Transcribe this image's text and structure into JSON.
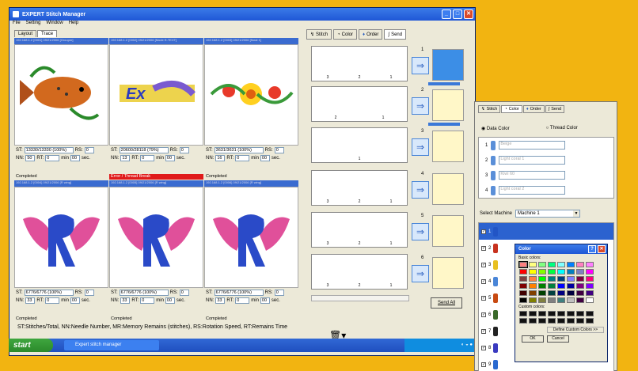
{
  "app": {
    "title": "EXPERT Stitch Manager",
    "menu": [
      "File",
      "Setting",
      "Window",
      "Help"
    ],
    "tabs": [
      "Layout",
      "Trace"
    ]
  },
  "grid": {
    "cells": [
      {
        "title": "192.168.1.2 [0001] 09/21/2006 [Grouper]",
        "st": "13330/13330 (100%)",
        "rs": "0",
        "nn": "50",
        "rt": "0",
        "min": "00",
        "status": "Completed",
        "status_kind": "ok",
        "design": "fish"
      },
      {
        "title": "192.168.1.2 [0002] 09/21/2006 [Mode E-TEXT]",
        "st": "20600/28118 (79%)",
        "rs": "0",
        "nn": "13",
        "rt": "0",
        "min": "00",
        "status": "Error / Thread Break",
        "status_kind": "err",
        "design": "text"
      },
      {
        "title": "192.168.1.2 [0003] 09/21/2006 [floral 1]",
        "st": "3631/3631 (100%)",
        "rs": "0",
        "nn": "16",
        "rt": "0",
        "min": "00",
        "status": "Completed",
        "status_kind": "ok",
        "design": "floral"
      },
      {
        "title": "192.168.1.2 [0004] 09/21/2006 [R wing]",
        "st": "6776/6776 (100%)",
        "rs": "0",
        "nn": "33",
        "rt": "0",
        "min": "00",
        "status": "Completed",
        "status_kind": "ok",
        "design": "wing"
      },
      {
        "title": "192.168.1.2 [0005] 09/21/2006 [R wing]",
        "st": "6776/6776 (100%)",
        "rs": "0",
        "nn": "33",
        "rt": "0",
        "min": "00",
        "status": "Completed",
        "status_kind": "ok",
        "design": "wing"
      },
      {
        "title": "192.168.1.2 [0006] 09/21/2006 [R wing]",
        "st": "6776/6776 (100%)",
        "rs": "0",
        "nn": "33",
        "rt": "0",
        "min": "00",
        "status": "Completed",
        "status_kind": "ok",
        "design": "wing"
      }
    ],
    "labels": {
      "st": "ST:",
      "rs": "RS:",
      "nn": "NN:",
      "rt": "RT:",
      "min": "min",
      "sec": "sec."
    }
  },
  "legend": "ST:Stitches/Total, NN:Needle Number, MR:Memory Remains (stitches), RS:Rotation Speed, RT:Remains Time",
  "panel": {
    "tabs": [
      "Stitch",
      "Color",
      "Order",
      "Send"
    ],
    "send_all": "Send All",
    "machines": [
      {
        "num": "1",
        "nums": [
          "3",
          "2",
          "1"
        ],
        "active": true
      },
      {
        "num": "2",
        "nums": [
          "2",
          "1"
        ],
        "active": false
      },
      {
        "num": "3",
        "nums": [
          "1"
        ],
        "active": false
      },
      {
        "num": "4",
        "nums": [
          "3",
          "2",
          "1"
        ],
        "active": false
      },
      {
        "num": "5",
        "nums": [
          "3",
          "2",
          "1"
        ],
        "active": false
      },
      {
        "num": "6",
        "nums": [
          "3",
          "2",
          "1"
        ],
        "active": false
      }
    ]
  },
  "taskbar": {
    "start": "start",
    "task": "Expert stitch manager"
  },
  "color_window": {
    "tabs": [
      "Stitch",
      "Color",
      "Order",
      "Send"
    ],
    "radio_data": "Data Color",
    "radio_thread": "Thread Color",
    "threads": [
      {
        "num": "1",
        "name": "Beige",
        "color": "#5a8fd8"
      },
      {
        "num": "2",
        "name": "Light coral 1",
        "color": "#5a8fd8"
      },
      {
        "num": "3",
        "name": "Kiwi 60",
        "color": "#5a8fd8"
      },
      {
        "num": "4",
        "name": "Light coral 2",
        "color": "#5a8fd8"
      }
    ],
    "select_machine_label": "Select Machine",
    "machine_value": "Machine 1",
    "list": [
      {
        "num": "1",
        "color": "#2255c5",
        "sel": true
      },
      {
        "num": "2",
        "color": "#c8321e",
        "sel": false
      },
      {
        "num": "3",
        "color": "#e8c020",
        "sel": false
      },
      {
        "num": "4",
        "color": "#4a86d8",
        "sel": false
      },
      {
        "num": "5",
        "color": "#c84a12",
        "sel": false
      },
      {
        "num": "6",
        "color": "#3a6a2a",
        "sel": false
      },
      {
        "num": "7",
        "color": "#222222",
        "sel": false
      },
      {
        "num": "8",
        "color": "#3a3ac0",
        "sel": false
      },
      {
        "num": "9",
        "color": "#2a6ad0",
        "sel": false
      }
    ]
  },
  "color_dialog": {
    "title": "Color",
    "basic_label": "Basic colors:",
    "custom_label": "Custom colors:",
    "define_label": "Define Custom Colors >>",
    "ok": "OK",
    "cancel": "Cancel",
    "basic_colors": [
      "#ff8080",
      "#ffff80",
      "#80ff80",
      "#00ff80",
      "#80ffff",
      "#0080ff",
      "#ff80c0",
      "#ff80ff",
      "#ff0000",
      "#ffff00",
      "#80ff00",
      "#00ff40",
      "#00ffff",
      "#0080c0",
      "#8080c0",
      "#ff00ff",
      "#804040",
      "#ff8040",
      "#00ff00",
      "#008080",
      "#004080",
      "#8080ff",
      "#800040",
      "#ff0080",
      "#800000",
      "#ff8000",
      "#008000",
      "#008040",
      "#0000ff",
      "#0000a0",
      "#800080",
      "#8000ff",
      "#400000",
      "#804000",
      "#004000",
      "#004040",
      "#000080",
      "#000040",
      "#400040",
      "#400080",
      "#000000",
      "#808000",
      "#808040",
      "#808080",
      "#408080",
      "#c0c0c0",
      "#400040",
      "#ffffff"
    ]
  }
}
